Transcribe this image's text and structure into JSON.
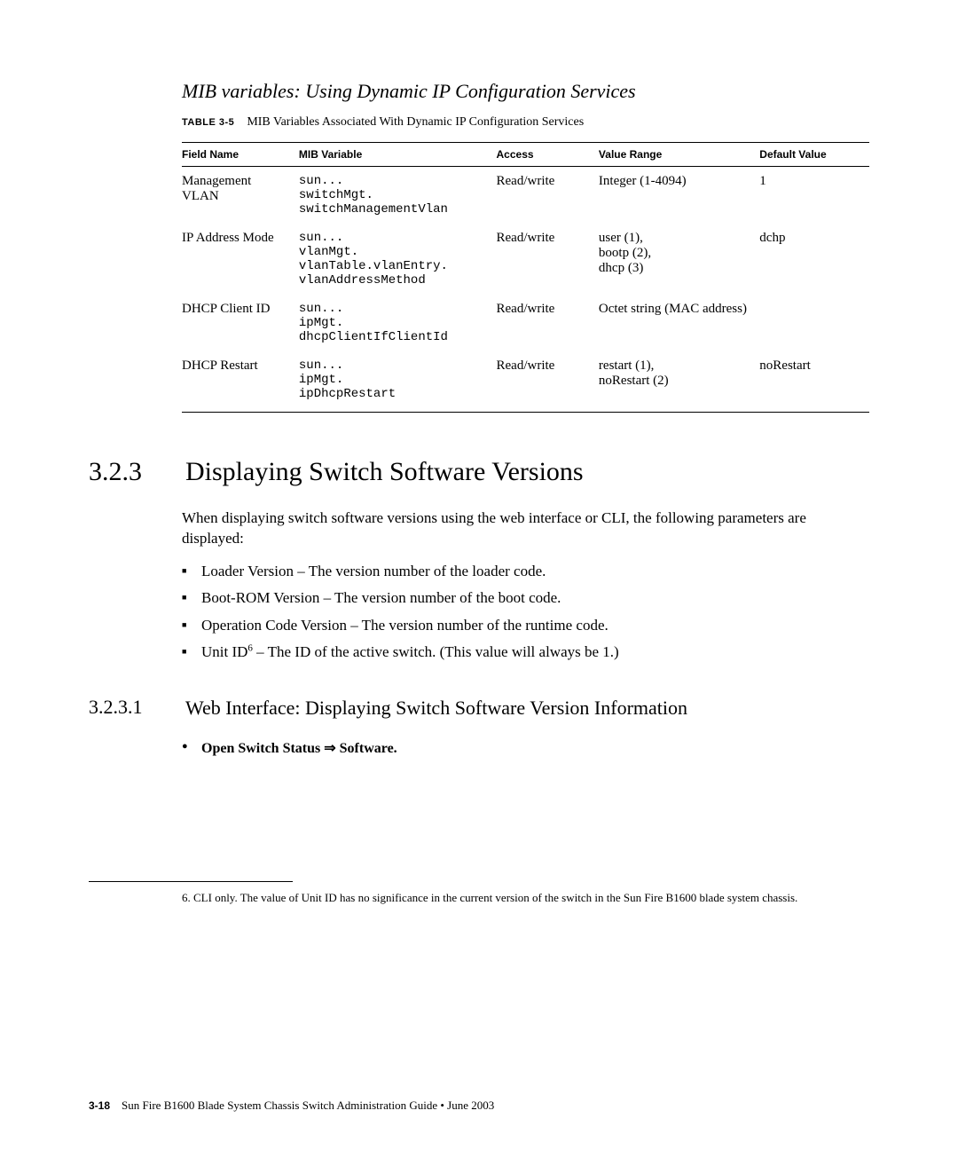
{
  "mib_section": {
    "title": "MIB variables: Using Dynamic IP Configuration Services",
    "table_label": "TABLE 3-5",
    "table_caption": "MIB Variables Associated With Dynamic IP Configuration Services",
    "headers": {
      "field": "Field Name",
      "mib": "MIB Variable",
      "access": "Access",
      "range": "Value Range",
      "default": "Default Value"
    },
    "rows": [
      {
        "field": "Management VLAN",
        "mib": "sun...\nswitchMgt.\nswitchManagementVlan",
        "access": "Read/write",
        "range": "Integer (1-4094)",
        "default": "1"
      },
      {
        "field": "IP Address Mode",
        "mib": "sun...\nvlanMgt.\nvlanTable.vlanEntry.\nvlanAddressMethod",
        "access": "Read/write",
        "range": "user (1),\nbootp (2),\ndhcp (3)",
        "default": "dchp"
      },
      {
        "field": "DHCP Client ID",
        "mib": "sun...\nipMgt.\ndhcpClientIfClientId",
        "access": "Read/write",
        "range": "Octet string (MAC address)",
        "default": ""
      },
      {
        "field": "DHCP Restart",
        "mib": "sun...\nipMgt.\nipDhcpRestart",
        "access": "Read/write",
        "range": "restart (1),\nnoRestart (2)",
        "default": "noRestart"
      }
    ]
  },
  "section_323": {
    "number": "3.2.3",
    "title": "Displaying Switch Software Versions",
    "intro": "When displaying switch software versions using the web interface or CLI, the following parameters are displayed:",
    "bullets": [
      "Loader Version – The version number of the loader code.",
      "Boot-ROM Version – The version number of the boot code.",
      "Operation Code Version – The version number of the runtime code."
    ],
    "bullet_unitid_prefix": "Unit ID",
    "bullet_unitid_sup": "6",
    "bullet_unitid_suffix": " – The ID of the active switch. (This value will always be 1.)"
  },
  "section_3231": {
    "number": "3.2.3.1",
    "title": "Web Interface: Displaying Switch Software Version Information",
    "step_prefix": "Open Switch Status ",
    "step_arrow": "⇒",
    "step_suffix": " Software."
  },
  "footnote": {
    "num": "6.",
    "text": " CLI only. The value of Unit ID has no significance in the current version of the switch in the Sun Fire B1600 blade system chassis."
  },
  "footer": {
    "page": "3-18",
    "text": "Sun Fire B1600 Blade System Chassis Switch Administration Guide • June 2003"
  }
}
